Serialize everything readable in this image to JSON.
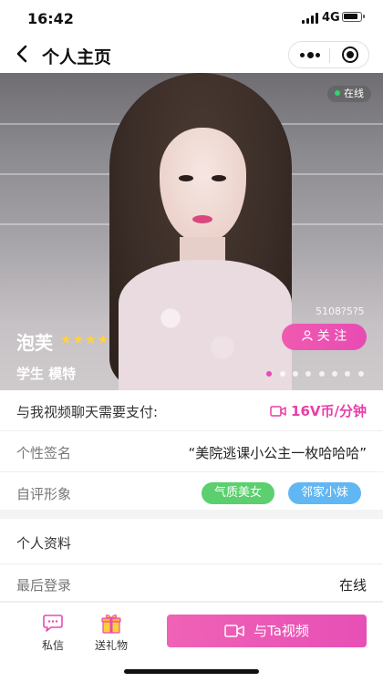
{
  "status_bar": {
    "time": "16:42",
    "network": "4G"
  },
  "nav": {
    "title": "个人主页"
  },
  "profile": {
    "online_badge": "在线",
    "user_id": "5108?5?5",
    "name": "泡芙",
    "stars": "★★★★",
    "follow_label": "关 注",
    "tags": "学生 模特",
    "carousel_count": 8,
    "carousel_active_index": 0
  },
  "video_pay": {
    "label": "与我视频聊天需要支付:",
    "price": "16V币/分钟"
  },
  "signature": {
    "label": "个性签名",
    "value": "“美院逃课小公主一枚哈哈哈”"
  },
  "self_image": {
    "label": "自评形象",
    "tags": [
      {
        "text": "气质美女",
        "color": "#5ccf6e"
      },
      {
        "text": "邻家小妹",
        "color": "#61b7f3"
      }
    ]
  },
  "details": {
    "section_title": "个人资料",
    "last_login_label": "最后登录",
    "last_login_value": "在线"
  },
  "bottom_bar": {
    "message_label": "私信",
    "gift_label": "送礼物",
    "video_call_label": "与Ta视频"
  },
  "colors": {
    "accent": "#e84bb4",
    "online_dot": "#2fd36b",
    "star": "#ffd23f"
  }
}
